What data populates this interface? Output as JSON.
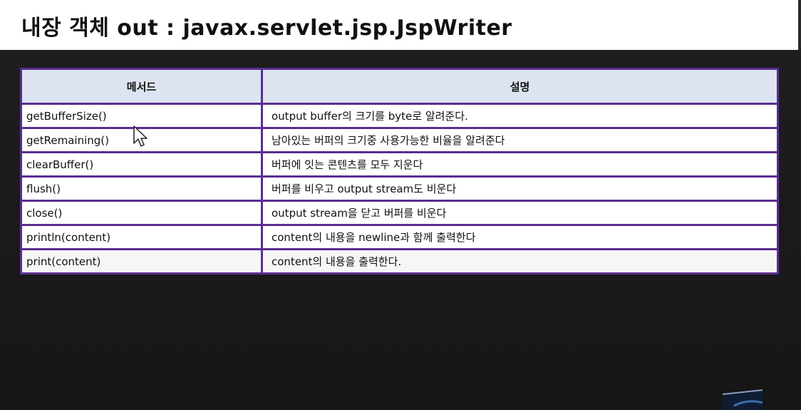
{
  "slide": {
    "title": "내장 객체 out : javax.servlet.jsp.JspWriter"
  },
  "table": {
    "headers": [
      "메서드",
      "설명"
    ],
    "rows": [
      {
        "method": "getBufferSize()",
        "description": "output buffer의 크기를 byte로 알려준다."
      },
      {
        "method": "getRemaining()",
        "description": "남아있는 버퍼의 크기중 사용가능한 비율을 알려준다"
      },
      {
        "method": "clearBuffer()",
        "description": "버퍼에 잇는 콘텐츠를 모두 지운다"
      },
      {
        "method": "flush()",
        "description": "버퍼를 비우고 output stream도 비운다"
      },
      {
        "method": "close()",
        "description": "output stream을 닫고 버퍼를 비운다"
      },
      {
        "method": "println(content)",
        "description": "content의 내용을 newline과 함께 출력한다"
      },
      {
        "method": "print(content)",
        "description": "content의 내용을 출력한다."
      }
    ]
  },
  "colors": {
    "table_border": "#5a2d90",
    "header_bg": "#dde4f1",
    "slide_bg": "#1c1c1c"
  },
  "icons": {
    "cursor": "mouse-pointer-icon"
  }
}
